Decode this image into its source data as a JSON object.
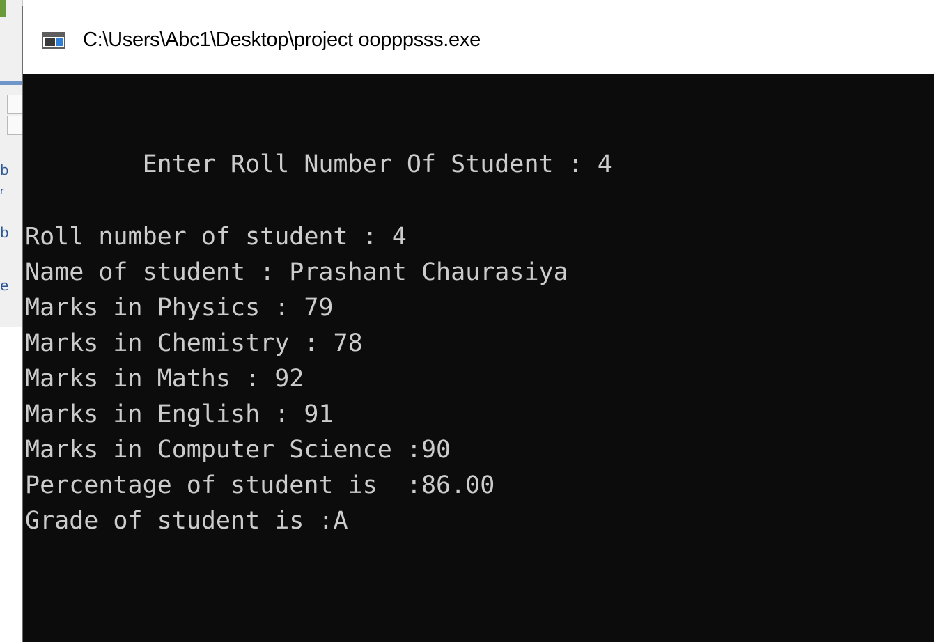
{
  "window": {
    "title": "C:\\Users\\Abc1\\Desktop\\project oopppsss.exe",
    "icon": "console-app-icon"
  },
  "console": {
    "prompt_line": "        Enter Roll Number Of Student : 4",
    "output_lines": [
      "Roll number of student : 4",
      "Name of student : Prashant Chaurasiya",
      "Marks in Physics : 79",
      "Marks in Chemistry : 78",
      "Marks in Maths : 92",
      "Marks in English : 91",
      "Marks in Computer Science :90",
      "Percentage of student is  :86.00",
      "Grade of student is :A"
    ]
  },
  "background_window": {
    "edge_fragments": [
      "b",
      "r",
      "b",
      "e"
    ]
  },
  "colors": {
    "console_background": "#0c0c0c",
    "console_text": "#cccccc",
    "title_bar": "#ffffff"
  }
}
